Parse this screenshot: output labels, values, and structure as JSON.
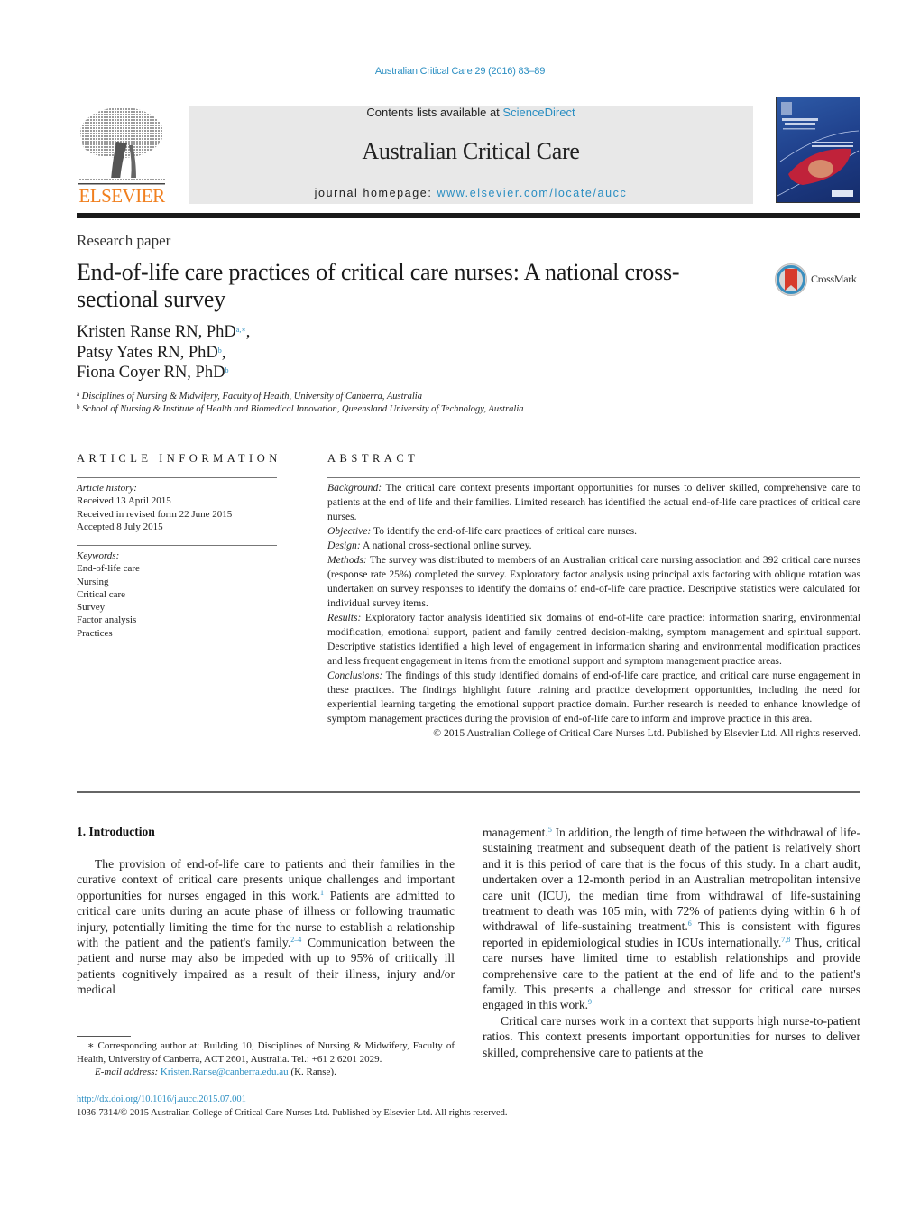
{
  "header": {
    "journal_citation": "Australian Critical Care 29 (2016) 83–89",
    "contents_prefix": "Contents lists available at ",
    "contents_link": "ScienceDirect",
    "journal_name": "Australian Critical Care",
    "homepage_prefix": "journal homepage: ",
    "homepage_link": "www.elsevier.com/locate/aucc",
    "publisher_logo_text": "ELSEVIER",
    "publisher_color": "#f07f1e",
    "link_color": "#2a8ec2"
  },
  "article": {
    "type": "Research paper",
    "title": "End-of-life care practices of critical care nurses: A national cross-sectional survey",
    "crossmark_label": "CrossMark",
    "authors": [
      {
        "name": "Kristen Ranse RN, PhD",
        "marks": "a,∗",
        "suffix": ","
      },
      {
        "name": "Patsy Yates RN, PhD",
        "marks": "b",
        "suffix": ","
      },
      {
        "name": "Fiona Coyer RN, PhD",
        "marks": "b",
        "suffix": ""
      }
    ],
    "affiliations": [
      {
        "mark": "a",
        "text": "Disciplines of Nursing & Midwifery, Faculty of Health, University of Canberra, Australia"
      },
      {
        "mark": "b",
        "text": "School of Nursing & Institute of Health and Biomedical Innovation, Queensland University of Technology, Australia"
      }
    ]
  },
  "article_info": {
    "heading": "ARTICLE INFORMATION",
    "history_label": "Article history:",
    "history": [
      "Received 13 April 2015",
      "Received in revised form 22 June 2015",
      "Accepted 8 July 2015"
    ],
    "keywords_label": "Keywords:",
    "keywords": [
      "End-of-life care",
      "Nursing",
      "Critical care",
      "Survey",
      "Factor analysis",
      "Practices"
    ]
  },
  "abstract": {
    "heading": "ABSTRACT",
    "sections": [
      {
        "label": "Background:",
        "text": " The critical care context presents important opportunities for nurses to deliver skilled, comprehensive care to patients at the end of life and their families. Limited research has identified the actual end-of-life care practices of critical care nurses."
      },
      {
        "label": "Objective:",
        "text": " To identify the end-of-life care practices of critical care nurses."
      },
      {
        "label": "Design:",
        "text": " A national cross-sectional online survey."
      },
      {
        "label": "Methods:",
        "text": " The survey was distributed to members of an Australian critical care nursing association and 392 critical care nurses (response rate 25%) completed the survey. Exploratory factor analysis using principal axis factoring with oblique rotation was undertaken on survey responses to identify the domains of end-of-life care practice. Descriptive statistics were calculated for individual survey items."
      },
      {
        "label": "Results:",
        "text": " Exploratory factor analysis identified six domains of end-of-life care practice: information sharing, environmental modification, emotional support, patient and family centred decision-making, symptom management and spiritual support. Descriptive statistics identified a high level of engagement in information sharing and environmental modification practices and less frequent engagement in items from the emotional support and symptom management practice areas."
      },
      {
        "label": "Conclusions:",
        "text": " The findings of this study identified domains of end-of-life care practice, and critical care nurse engagement in these practices. The findings highlight future training and practice development opportunities, including the need for experiential learning targeting the emotional support practice domain. Further research is needed to enhance knowledge of symptom management practices during the provision of end-of-life care to inform and improve practice in this area."
      }
    ],
    "copyright": "© 2015 Australian College of Critical Care Nurses Ltd. Published by Elsevier Ltd. All rights reserved."
  },
  "introduction": {
    "heading": "1.  Introduction",
    "left_col": {
      "p1_a": "The provision of end-of-life care to patients and their families in the curative context of critical care presents unique challenges and important opportunities for nurses engaged in this work.",
      "p1_ref1": "1",
      "p1_b": " Patients are admitted to critical care units during an acute phase of illness or following traumatic injury, potentially limiting the time for the nurse to establish a relationship with the patient and the patient's family.",
      "p1_ref2": "2–4",
      "p1_c": " Communication between the patient and nurse may also be impeded with up to 95% of critically ill patients cognitively impaired as a result of their illness, injury and/or medical"
    },
    "right_col": {
      "c_a": "management.",
      "c_ref5": "5",
      "c_b": " In addition, the length of time between the withdrawal of life-sustaining treatment and subsequent death of the patient is relatively short and it is this period of care that is the focus of this study. In a chart audit, undertaken over a 12-month period in an Australian metropolitan intensive care unit (ICU), the median time from withdrawal of life-sustaining treatment to death was 105 min, with 72% of patients dying within 6 h of withdrawal of life-sustaining treatment.",
      "c_ref6": "6",
      "c_c": " This is consistent with figures reported in epidemiological studies in ICUs internationally.",
      "c_ref78": "7,8",
      "c_d": " Thus, critical care nurses have limited time to establish relationships and provide comprehensive care to the patient at the end of life and to the patient's family. This presents a challenge and stressor for critical care nurses engaged in this work.",
      "c_ref9": "9",
      "p2": "Critical care nurses work in a context that supports high nurse-to-patient ratios. This context presents important opportunities for nurses to deliver skilled, comprehensive care to patients at the"
    }
  },
  "footnote": {
    "corresponding": "∗  Corresponding author at: Building 10, Disciplines of Nursing & Midwifery, Faculty of Health, University of Canberra, ACT 2601, Australia. Tel.: +61 2 6201 2029.",
    "email_label": "E-mail address:",
    "email": "Kristen.Ranse@canberra.edu.au",
    "email_suffix": " (K. Ranse)."
  },
  "doi": {
    "link": "http://dx.doi.org/10.1016/j.aucc.2015.07.001",
    "issn_line": "1036-7314/© 2015 Australian College of Critical Care Nurses Ltd. Published by Elsevier Ltd. All rights reserved."
  }
}
